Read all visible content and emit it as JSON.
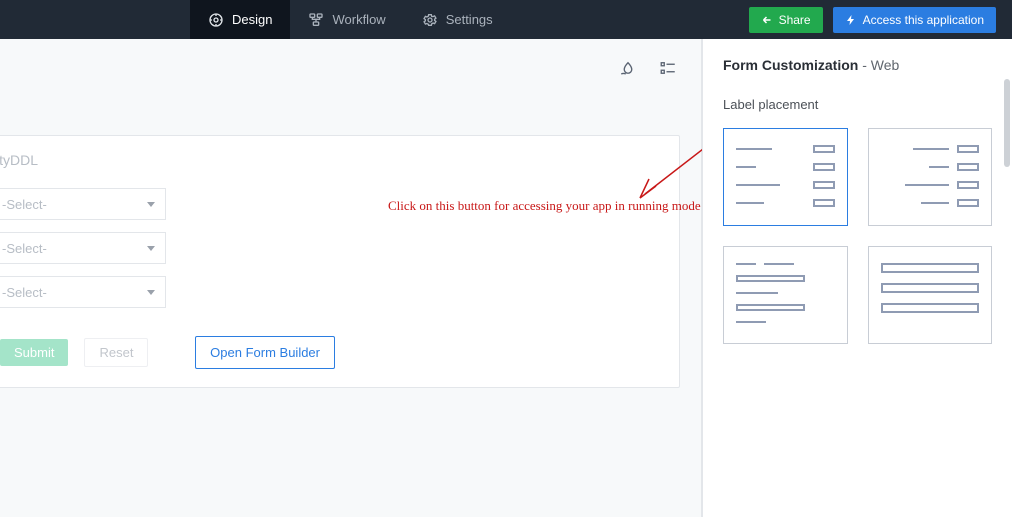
{
  "topbar": {
    "tabs": {
      "design": "Design",
      "workflow": "Workflow",
      "settings": "Settings"
    },
    "share_label": "Share",
    "access_label": "Access this application"
  },
  "form": {
    "top_label": "ityDDL",
    "select_placeholder": "-Select-",
    "submit_label": "Submit",
    "reset_label": "Reset",
    "open_builder_label": "Open Form Builder"
  },
  "annotation": {
    "text": "Click on this button for accessing your app in running mode"
  },
  "side": {
    "title_bold": "Form Customization",
    "title_sep": " - ",
    "title_rest": "Web",
    "section_label": "Label placement"
  }
}
